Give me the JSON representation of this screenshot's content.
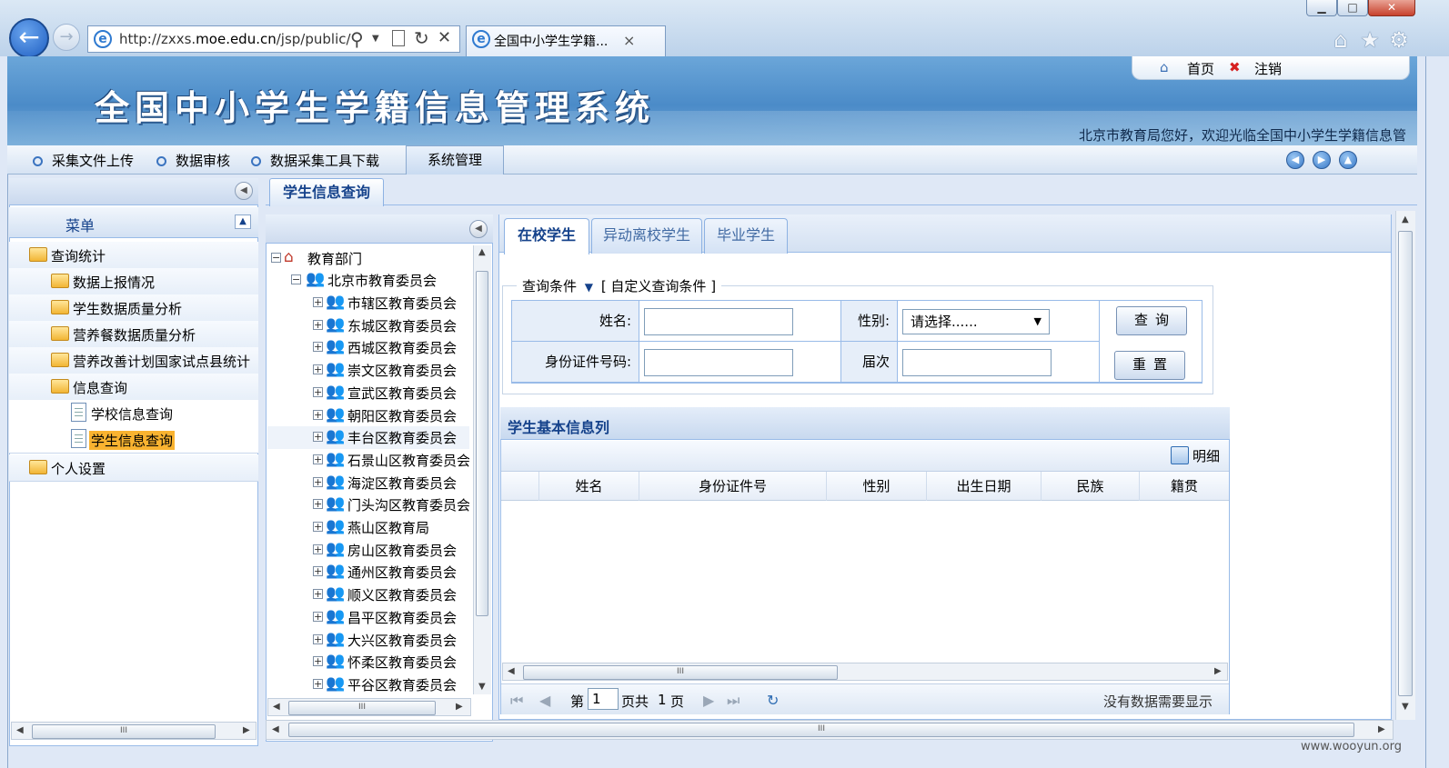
{
  "browser": {
    "url": "http://zxxs.moe.edu.cn/jsp/public/",
    "url_prefix": "http://zxxs.",
    "url_domain": "moe.edu.cn",
    "url_path": "/jsp/public/",
    "tab_title": "全国中小学生学籍...",
    "tab_close": "×",
    "back_glyph": "←",
    "forward_glyph": "→",
    "min_glyph": "▁",
    "max_glyph": "□",
    "close_glyph": "✕",
    "search_glyph": "⚲",
    "refresh_glyph": "↻",
    "stop_glyph": "✕",
    "home_glyph": "⌂",
    "fav_glyph": "★",
    "tools_glyph": "⚙"
  },
  "header": {
    "system_title": "全国中小学生学籍信息管理系统",
    "home_link": "首页",
    "logout_link": "注销",
    "welcome": "北京市教育局您好，欢迎光临全国中小学生学籍信息管"
  },
  "nav": {
    "items": [
      "采集文件上传",
      "数据审核",
      "数据采集工具下载"
    ],
    "active": "系统管理"
  },
  "left_menu": {
    "title": "菜单",
    "items": [
      {
        "label": "查询统计"
      },
      {
        "label": "数据上报情况"
      },
      {
        "label": "学生数据质量分析"
      },
      {
        "label": "营养餐数据质量分析"
      },
      {
        "label": "营养改善计划国家试点县统计"
      },
      {
        "label": "信息查询"
      },
      {
        "label": "学校信息查询"
      },
      {
        "label": "学生信息查询"
      },
      {
        "label": "个人设置"
      }
    ]
  },
  "main_tab": "学生信息查询",
  "tree": {
    "root": "教育部门",
    "level1": "北京市教育委员会",
    "children": [
      "市辖区教育委员会",
      "东城区教育委员会",
      "西城区教育委员会",
      "崇文区教育委员会",
      "宣武区教育委员会",
      "朝阳区教育委员会",
      "丰台区教育委员会",
      "石景山区教育委员会",
      "海淀区教育委员会",
      "门头沟区教育委员会",
      "燕山区教育局",
      "房山区教育委员会",
      "通州区教育委员会",
      "顺义区教育委员会",
      "昌平区教育委员会",
      "大兴区教育委员会",
      "怀柔区教育委员会",
      "平谷区教育委员会"
    ]
  },
  "inner_tabs": [
    "在校学生",
    "异动离校学生",
    "毕业学生"
  ],
  "query": {
    "legend": "查询条件",
    "custom_link": "[ 自定义查询条件 ]",
    "name_label": "姓名:",
    "gender_label": "性别:",
    "gender_value": "请选择......",
    "id_label": "身份证件号码:",
    "grade_label": "届次",
    "search_btn": "查询",
    "reset_btn": "重置"
  },
  "grid": {
    "title": "学生基本信息列",
    "detail_btn": "明细",
    "columns": [
      "姓名",
      "身份证件号",
      "性别",
      "出生日期",
      "民族",
      "籍贯"
    ],
    "rows": [],
    "page_prefix": "第",
    "page_value": "1",
    "page_suffix": "页共",
    "page_total": "1",
    "page_unit": "页",
    "empty_msg": "没有数据需要显示"
  },
  "scroll_thumb": "III",
  "watermark": "www.wooyun.org",
  "colors": {
    "accent": "#15428b",
    "border": "#99bbe8",
    "highlight": "#f9b330",
    "banner": "#4b8bc8"
  }
}
